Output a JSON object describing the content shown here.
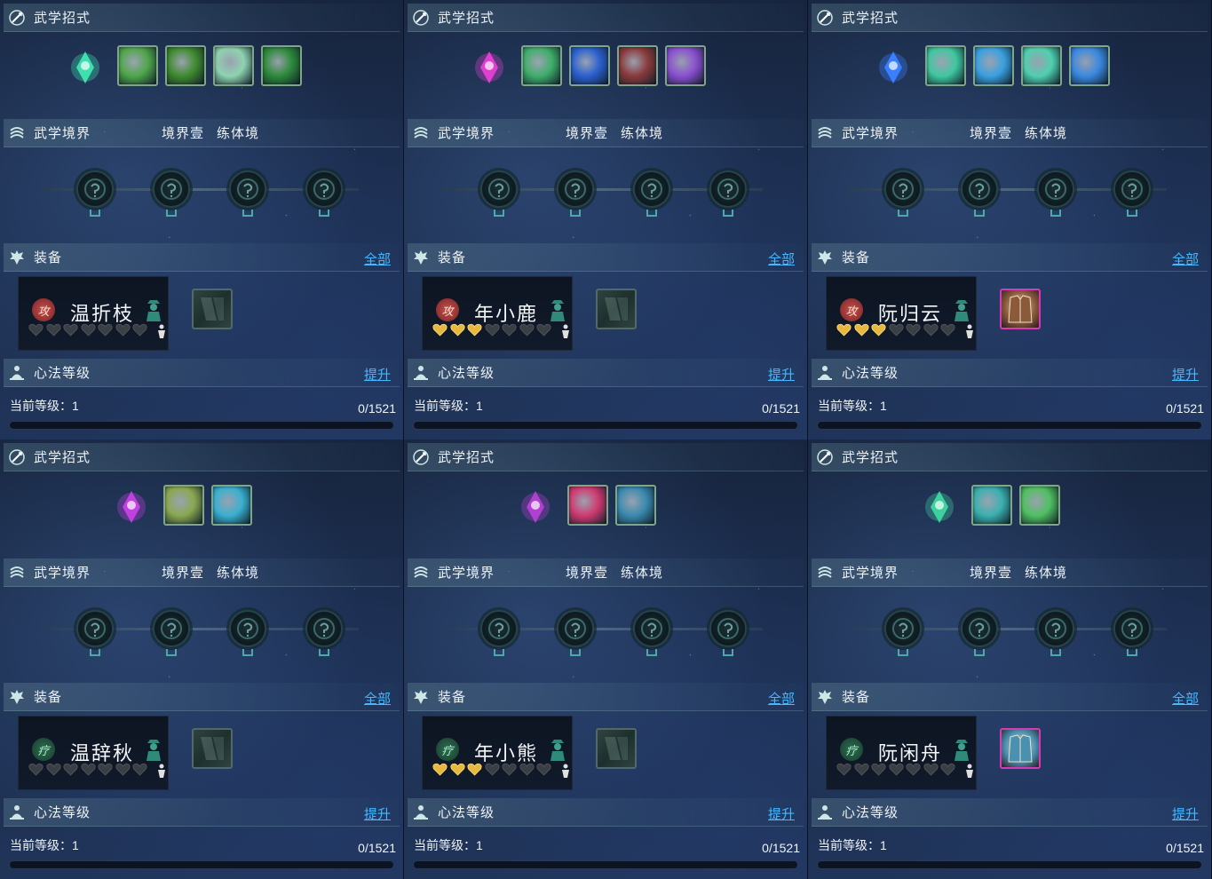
{
  "labels": {
    "skills_title": "武学招式",
    "realm_title": "武学境界",
    "equip_title": "装备",
    "equip_link": "全部",
    "xinfa_title": "心法等级",
    "xinfa_link": "提升"
  },
  "panels": [
    {
      "realm_level": "境界壹",
      "realm_stage": "练体境",
      "skill_main_color": "#3fe0b0",
      "skill_icons": [
        "#4fa64a",
        "#3f8a2e",
        "#8fd3b0",
        "#2c8a3a"
      ],
      "companion": {
        "name": "温折枝",
        "role_glyph": "攻",
        "role": "attack",
        "filled_hearts": 0,
        "total_hearts": 7
      },
      "equip_color": null,
      "current_level_text": "当前等级：1",
      "exp_text": "0/1521",
      "progress": 0
    },
    {
      "realm_level": "境界壹",
      "realm_stage": "练体境",
      "skill_main_color": "#e040d0",
      "skill_icons": [
        "#3fae6a",
        "#2a5fd0",
        "#8a3a3a",
        "#8a4fd0"
      ],
      "companion": {
        "name": "年小鹿",
        "role_glyph": "攻",
        "role": "attack",
        "filled_hearts": 3,
        "total_hearts": 7
      },
      "equip_color": null,
      "current_level_text": "当前等级：1",
      "exp_text": "0/1521",
      "progress": 0
    },
    {
      "realm_level": "境界壹",
      "realm_stage": "练体境",
      "skill_main_color": "#3a7fff",
      "skill_icons": [
        "#3fc8a0",
        "#3aa0e0",
        "#4fd0b0",
        "#3a88e0"
      ],
      "companion": {
        "name": "阮归云",
        "role_glyph": "攻",
        "role": "attack",
        "filled_hearts": 3,
        "total_hearts": 7
      },
      "equip_color": "#8a5a3a",
      "current_level_text": "当前等级：1",
      "exp_text": "0/1521",
      "progress": 0
    },
    {
      "realm_level": "境界壹",
      "realm_stage": "练体境",
      "skill_main_color": "#c040e0",
      "skill_icons": [
        "#8aa850",
        "#3ab0d0"
      ],
      "companion": {
        "name": "温辞秋",
        "role_glyph": "疗",
        "role": "heal",
        "filled_hearts": 0,
        "total_hearts": 7
      },
      "equip_color": null,
      "current_level_text": "当前等级：1",
      "exp_text": "0/1521",
      "progress": 0
    },
    {
      "realm_level": "境界壹",
      "realm_stage": "练体境",
      "skill_main_color": "#b040d0",
      "skill_icons": [
        "#d03a70",
        "#3a8ab0"
      ],
      "companion": {
        "name": "年小熊",
        "role_glyph": "疗",
        "role": "heal",
        "filled_hearts": 3,
        "total_hearts": 7
      },
      "equip_color": null,
      "current_level_text": "当前等级：1",
      "exp_text": "0/1521",
      "progress": 0
    },
    {
      "realm_level": "境界壹",
      "realm_stage": "练体境",
      "skill_main_color": "#3fd0a0",
      "skill_icons": [
        "#3ab0b0",
        "#4fc060"
      ],
      "companion": {
        "name": "阮闲舟",
        "role_glyph": "疗",
        "role": "heal",
        "filled_hearts": 0,
        "total_hearts": 7
      },
      "equip_color": "#4a90b0",
      "current_level_text": "当前等级：1",
      "exp_text": "0/1521",
      "progress": 0
    }
  ]
}
